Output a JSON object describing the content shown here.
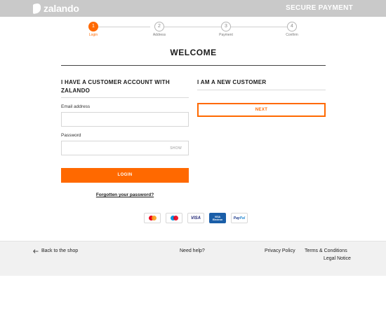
{
  "header": {
    "brand": "zalando",
    "secure_label": "SECURE PAYMENT"
  },
  "stepper": {
    "steps": [
      {
        "number": "1",
        "label": "Login",
        "active": true
      },
      {
        "number": "2",
        "label": "Address",
        "active": false
      },
      {
        "number": "3",
        "label": "Payment",
        "active": false
      },
      {
        "number": "4",
        "label": "Confirm",
        "active": false
      }
    ]
  },
  "welcome": "WELCOME",
  "existing_customer": {
    "title": "I HAVE A CUSTOMER ACCOUNT WITH ZALANDO",
    "email_label": "Email address",
    "email_value": "",
    "password_label": "Password",
    "password_value": "",
    "show_label": "SHOW",
    "login_button": "LOGIN",
    "forgot_link": "Forgotten your password?"
  },
  "new_customer": {
    "title": "I AM A NEW CUSTOMER",
    "next_button": "NEXT"
  },
  "payments": {
    "visa": "VISA",
    "velocity_line1": "VISA",
    "velocity_line2": "Electron",
    "paypal_a": "Pay",
    "paypal_b": "Pal"
  },
  "footer": {
    "back": "Back to the shop",
    "help": "Need help?",
    "privacy": "Privacy Policy",
    "terms": "Terms & Conditions",
    "legal": "Legal Notice"
  },
  "colors": {
    "accent": "#ff6900",
    "header_bg": "#c9c9c9",
    "footer_bg": "#f1f1f1"
  }
}
